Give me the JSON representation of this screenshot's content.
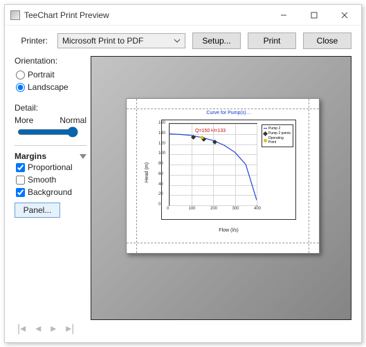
{
  "window": {
    "title": "TeeChart Print Preview"
  },
  "top": {
    "printer_label": "Printer:",
    "printer_value": "Microsoft Print to PDF",
    "setup_label": "Setup...",
    "print_label": "Print",
    "close_label": "Close"
  },
  "sidebar": {
    "orientation_label": "Orientation:",
    "portrait_label": "Portrait",
    "landscape_label": "Landscape",
    "orientation_value": "Landscape",
    "detail_label": "Detail:",
    "detail_more": "More",
    "detail_normal": "Normal",
    "margins_label": "Margins",
    "proportional_label": "Proportional",
    "proportional_value": true,
    "smooth_label": "Smooth",
    "smooth_value": false,
    "background_label": "Background",
    "background_value": true,
    "panel_label": "Panel..."
  },
  "chart_data": {
    "type": "line",
    "title": "Curve for Pump(s)…",
    "xlabel": "Flow (l/s)",
    "ylabel": "Head (m)",
    "xlim": [
      0,
      400
    ],
    "ylim": [
      0,
      160
    ],
    "xticks": [
      0,
      100,
      200,
      300,
      400
    ],
    "yticks": [
      0,
      20,
      40,
      60,
      80,
      100,
      120,
      140,
      160
    ],
    "series": [
      {
        "name": "Pump 2",
        "type": "line",
        "x": [
          0,
          50,
          100,
          150,
          200,
          250,
          300,
          350,
          400
        ],
        "y": [
          140,
          139,
          137,
          133,
          127,
          118,
          104,
          80,
          10
        ]
      },
      {
        "name": "Pump 2 points",
        "type": "scatter",
        "x": [
          100,
          150,
          200
        ],
        "y": [
          137,
          133,
          127
        ]
      },
      {
        "name": "Operating Point",
        "type": "scatter",
        "x": [
          150
        ],
        "y": [
          133
        ]
      }
    ],
    "annotation": {
      "text": "Q=150 H=133",
      "x": 180,
      "y": 140
    },
    "legend": [
      "Pump 2",
      "Pump 2 points",
      "Operating Point"
    ]
  }
}
